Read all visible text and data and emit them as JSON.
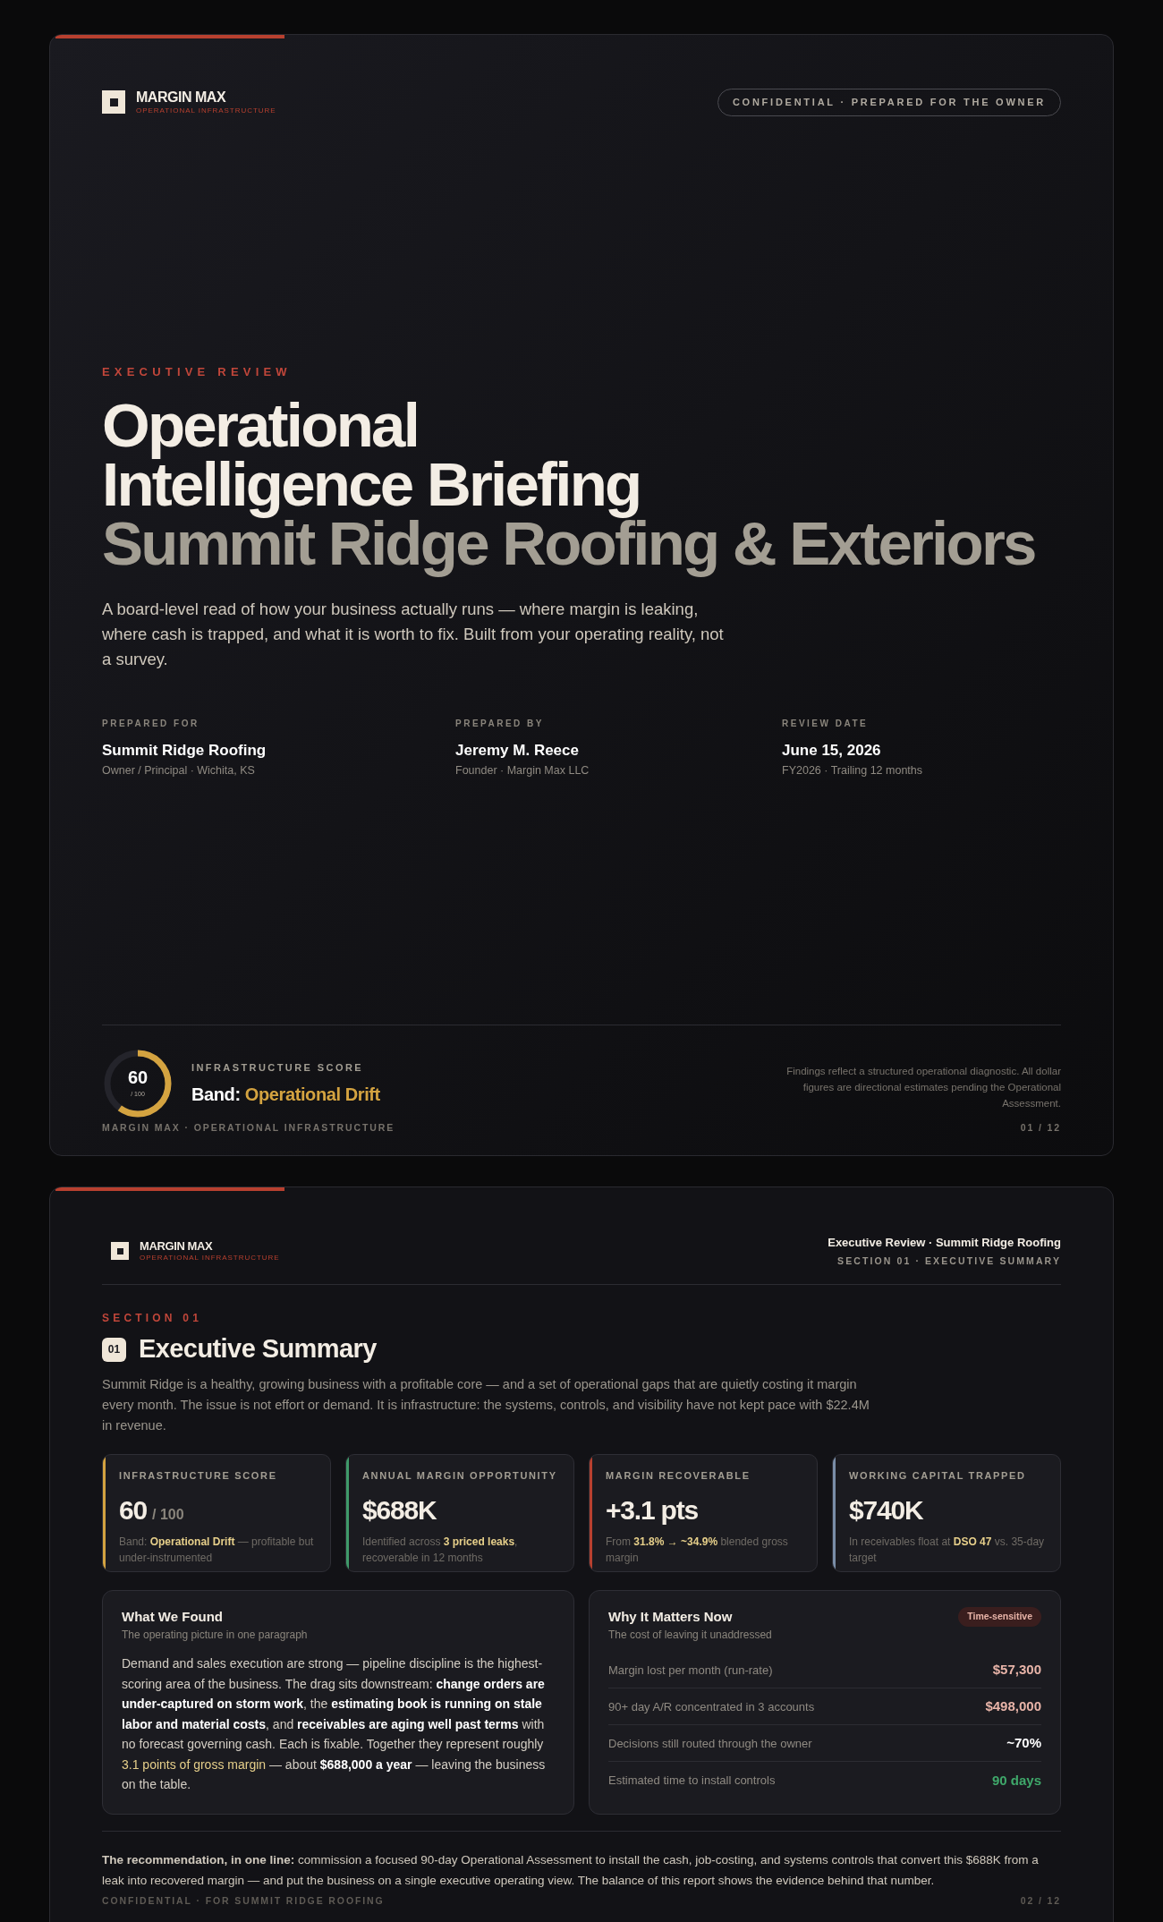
{
  "cover": {
    "brand": {
      "name": "MARGIN MAX",
      "tagline": "OPERATIONAL INFRASTRUCTURE"
    },
    "confidential": "CONFIDENTIAL · PREPARED FOR THE OWNER",
    "eyebrow": "EXECUTIVE REVIEW",
    "title_lines": [
      "Operational",
      "Intelligence Briefing"
    ],
    "subtitle": "Summit Ridge Roofing & Exteriors",
    "lead": "A board-level read of how your business actually runs — where margin is leaking, where cash is trapped, and what it is worth to fix. Built from your operating reality, not a survey.",
    "meta": [
      {
        "label": "PREPARED FOR",
        "value": "Summit Ridge Roofing",
        "sub": "Owner / Principal · Wichita, KS"
      },
      {
        "label": "PREPARED BY",
        "value": "Jeremy M. Reece",
        "sub": "Founder · Margin Max LLC"
      },
      {
        "label": "REVIEW DATE",
        "value": "June 15, 2026",
        "sub": "FY2026 · Trailing 12 months"
      }
    ],
    "score": {
      "value": "60",
      "scale": "/ 100",
      "level": 0.6,
      "label": "INFRASTRUCTURE SCORE",
      "band_prefix": "Band:",
      "band": "Operational Drift"
    },
    "disclaimer": "Findings reflect a structured operational diagnostic. All dollar figures are directional estimates pending the Operational Assessment.",
    "footer_left": "MARGIN MAX · OPERATIONAL INFRASTRUCTURE",
    "footer_right": "01 / 12"
  },
  "summary": {
    "brand": {
      "name": "MARGIN MAX",
      "tagline": "OPERATIONAL INFRASTRUCTURE"
    },
    "header_title": "Executive Review · Summit Ridge Roofing",
    "header_sub": "SECTION 01 · EXECUTIVE SUMMARY",
    "eyebrow": "SECTION 01",
    "number": "01",
    "title": "Executive Summary",
    "intro": "Summit Ridge is a healthy, growing business with a profitable core — and a set of operational gaps that are quietly costing it margin every month. The issue is not effort or demand. It is infrastructure: the systems, controls, and visibility have not kept pace with $22.4M in revenue.",
    "kpis": [
      {
        "label": "INFRASTRUCTURE SCORE",
        "value": "60",
        "unit": "/ 100",
        "color": "#d4a340",
        "note": [
          {
            "kind": "plain",
            "text": "Band: "
          },
          {
            "kind": "accent",
            "text": "Operational Drift"
          },
          {
            "kind": "plain",
            "text": " — profitable but under-instrumented"
          }
        ]
      },
      {
        "label": "ANNUAL MARGIN OPPORTUNITY",
        "value": "$688K",
        "color": "#3f9a6a",
        "note": [
          {
            "kind": "plain",
            "text": "Identified across "
          },
          {
            "kind": "accent",
            "text": "3 priced leaks"
          },
          {
            "kind": "plain",
            "text": ", recoverable in 12 months"
          }
        ]
      },
      {
        "label": "MARGIN RECOVERABLE",
        "value": "+3.1 pts",
        "color": "#b8402f",
        "note": [
          {
            "kind": "plain",
            "text": "From "
          },
          {
            "kind": "accent",
            "text": "31.8% → ~34.9%"
          },
          {
            "kind": "plain",
            "text": " blended gross margin"
          }
        ]
      },
      {
        "label": "WORKING CAPITAL TRAPPED",
        "value": "$740K",
        "color": "#7a8ea8",
        "note": [
          {
            "kind": "plain",
            "text": "In receivables float at "
          },
          {
            "kind": "accent",
            "text": "DSO 47"
          },
          {
            "kind": "plain",
            "text": " vs. 35-day target"
          }
        ]
      }
    ],
    "found": {
      "title": "What We Found",
      "sub": "The operating picture in one paragraph",
      "body": [
        {
          "kind": "plain",
          "text": "Demand and sales execution are strong — pipeline discipline is the highest-scoring area of the business. The drag sits downstream: "
        },
        {
          "kind": "bold",
          "text": "change orders are under-captured on storm work"
        },
        {
          "kind": "plain",
          "text": ", the "
        },
        {
          "kind": "bold",
          "text": "estimating book is running on stale labor and material costs"
        },
        {
          "kind": "plain",
          "text": ", and "
        },
        {
          "kind": "bold",
          "text": "receivables are aging well past terms"
        },
        {
          "kind": "plain",
          "text": " with no forecast governing cash. Each is fixable. Together they represent roughly "
        },
        {
          "kind": "highlight",
          "text": "3.1 points of gross margin"
        },
        {
          "kind": "plain",
          "text": " — about "
        },
        {
          "kind": "bold",
          "text": "$688,000 a year"
        },
        {
          "kind": "plain",
          "text": " — leaving the business on the table."
        }
      ]
    },
    "matters": {
      "title": "Why It Matters Now",
      "sub": "The cost of leaving it unaddressed",
      "badge": "Time-sensitive",
      "rows": [
        {
          "label": "Margin lost per month (run-rate)",
          "value": "$57,300",
          "color": "#e8b4a8"
        },
        {
          "label": "90+ day A/R concentrated in 3 accounts",
          "value": "$498,000",
          "color": "#e8b4a8"
        },
        {
          "label": "Decisions still routed through the owner",
          "value": "~70%",
          "color": "#ffffff"
        },
        {
          "label": "Estimated time to install controls",
          "value": "90 days",
          "color": "#3fa86a"
        }
      ]
    },
    "recommendation": "**The recommendation, in one line:** commission a focused 90-day Operational Assessment to install the cash, job-costing, and systems controls that convert this $688K from a leak into recovered margin — and put the business on a single executive operating view. The balance of this report shows the evidence behind that number.",
    "footer_left": "CONFIDENTIAL · FOR SUMMIT RIDGE ROOFING",
    "footer_right": "02 / 12"
  }
}
